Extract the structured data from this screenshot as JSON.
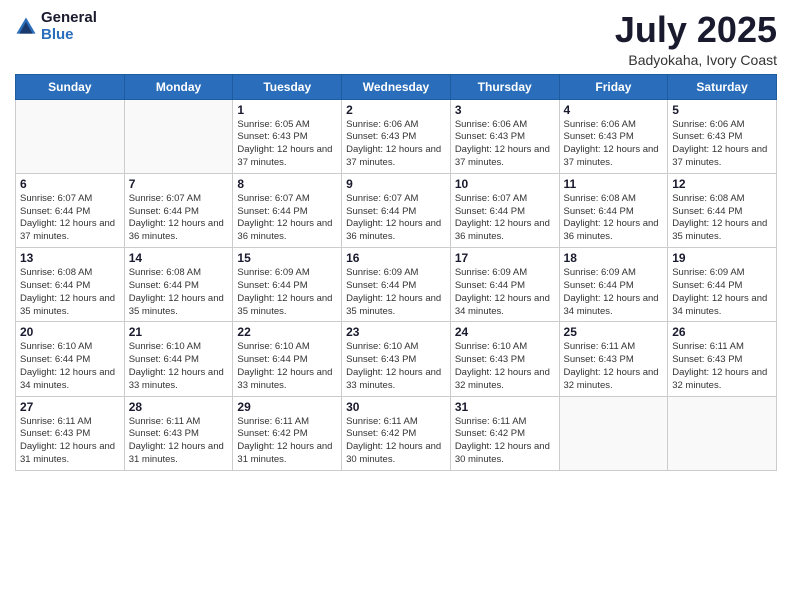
{
  "logo": {
    "general": "General",
    "blue": "Blue"
  },
  "header": {
    "title": "July 2025",
    "subtitle": "Badyokaha, Ivory Coast"
  },
  "weekdays": [
    "Sunday",
    "Monday",
    "Tuesday",
    "Wednesday",
    "Thursday",
    "Friday",
    "Saturday"
  ],
  "weeks": [
    [
      {
        "day": "",
        "info": ""
      },
      {
        "day": "",
        "info": ""
      },
      {
        "day": "1",
        "info": "Sunrise: 6:05 AM\nSunset: 6:43 PM\nDaylight: 12 hours and 37 minutes."
      },
      {
        "day": "2",
        "info": "Sunrise: 6:06 AM\nSunset: 6:43 PM\nDaylight: 12 hours and 37 minutes."
      },
      {
        "day": "3",
        "info": "Sunrise: 6:06 AM\nSunset: 6:43 PM\nDaylight: 12 hours and 37 minutes."
      },
      {
        "day": "4",
        "info": "Sunrise: 6:06 AM\nSunset: 6:43 PM\nDaylight: 12 hours and 37 minutes."
      },
      {
        "day": "5",
        "info": "Sunrise: 6:06 AM\nSunset: 6:43 PM\nDaylight: 12 hours and 37 minutes."
      }
    ],
    [
      {
        "day": "6",
        "info": "Sunrise: 6:07 AM\nSunset: 6:44 PM\nDaylight: 12 hours and 37 minutes."
      },
      {
        "day": "7",
        "info": "Sunrise: 6:07 AM\nSunset: 6:44 PM\nDaylight: 12 hours and 36 minutes."
      },
      {
        "day": "8",
        "info": "Sunrise: 6:07 AM\nSunset: 6:44 PM\nDaylight: 12 hours and 36 minutes."
      },
      {
        "day": "9",
        "info": "Sunrise: 6:07 AM\nSunset: 6:44 PM\nDaylight: 12 hours and 36 minutes."
      },
      {
        "day": "10",
        "info": "Sunrise: 6:07 AM\nSunset: 6:44 PM\nDaylight: 12 hours and 36 minutes."
      },
      {
        "day": "11",
        "info": "Sunrise: 6:08 AM\nSunset: 6:44 PM\nDaylight: 12 hours and 36 minutes."
      },
      {
        "day": "12",
        "info": "Sunrise: 6:08 AM\nSunset: 6:44 PM\nDaylight: 12 hours and 35 minutes."
      }
    ],
    [
      {
        "day": "13",
        "info": "Sunrise: 6:08 AM\nSunset: 6:44 PM\nDaylight: 12 hours and 35 minutes."
      },
      {
        "day": "14",
        "info": "Sunrise: 6:08 AM\nSunset: 6:44 PM\nDaylight: 12 hours and 35 minutes."
      },
      {
        "day": "15",
        "info": "Sunrise: 6:09 AM\nSunset: 6:44 PM\nDaylight: 12 hours and 35 minutes."
      },
      {
        "day": "16",
        "info": "Sunrise: 6:09 AM\nSunset: 6:44 PM\nDaylight: 12 hours and 35 minutes."
      },
      {
        "day": "17",
        "info": "Sunrise: 6:09 AM\nSunset: 6:44 PM\nDaylight: 12 hours and 34 minutes."
      },
      {
        "day": "18",
        "info": "Sunrise: 6:09 AM\nSunset: 6:44 PM\nDaylight: 12 hours and 34 minutes."
      },
      {
        "day": "19",
        "info": "Sunrise: 6:09 AM\nSunset: 6:44 PM\nDaylight: 12 hours and 34 minutes."
      }
    ],
    [
      {
        "day": "20",
        "info": "Sunrise: 6:10 AM\nSunset: 6:44 PM\nDaylight: 12 hours and 34 minutes."
      },
      {
        "day": "21",
        "info": "Sunrise: 6:10 AM\nSunset: 6:44 PM\nDaylight: 12 hours and 33 minutes."
      },
      {
        "day": "22",
        "info": "Sunrise: 6:10 AM\nSunset: 6:44 PM\nDaylight: 12 hours and 33 minutes."
      },
      {
        "day": "23",
        "info": "Sunrise: 6:10 AM\nSunset: 6:43 PM\nDaylight: 12 hours and 33 minutes."
      },
      {
        "day": "24",
        "info": "Sunrise: 6:10 AM\nSunset: 6:43 PM\nDaylight: 12 hours and 32 minutes."
      },
      {
        "day": "25",
        "info": "Sunrise: 6:11 AM\nSunset: 6:43 PM\nDaylight: 12 hours and 32 minutes."
      },
      {
        "day": "26",
        "info": "Sunrise: 6:11 AM\nSunset: 6:43 PM\nDaylight: 12 hours and 32 minutes."
      }
    ],
    [
      {
        "day": "27",
        "info": "Sunrise: 6:11 AM\nSunset: 6:43 PM\nDaylight: 12 hours and 31 minutes."
      },
      {
        "day": "28",
        "info": "Sunrise: 6:11 AM\nSunset: 6:43 PM\nDaylight: 12 hours and 31 minutes."
      },
      {
        "day": "29",
        "info": "Sunrise: 6:11 AM\nSunset: 6:42 PM\nDaylight: 12 hours and 31 minutes."
      },
      {
        "day": "30",
        "info": "Sunrise: 6:11 AM\nSunset: 6:42 PM\nDaylight: 12 hours and 30 minutes."
      },
      {
        "day": "31",
        "info": "Sunrise: 6:11 AM\nSunset: 6:42 PM\nDaylight: 12 hours and 30 minutes."
      },
      {
        "day": "",
        "info": ""
      },
      {
        "day": "",
        "info": ""
      }
    ]
  ]
}
